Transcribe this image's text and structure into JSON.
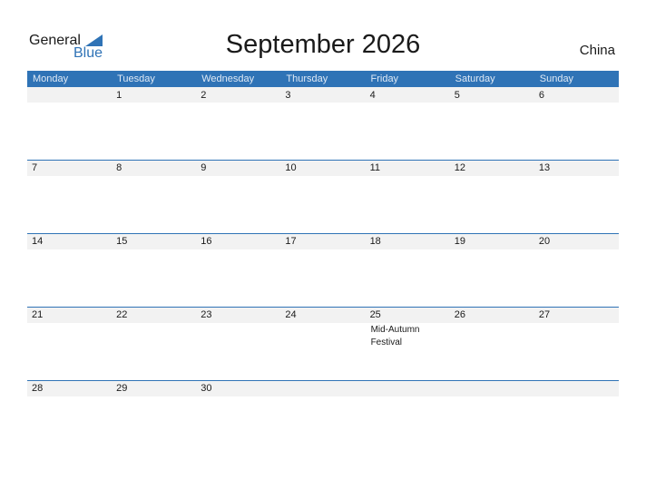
{
  "logo": {
    "text_general": "General",
    "text_blue": "Blue"
  },
  "title": "September 2026",
  "country": "China",
  "colors": {
    "accent": "#2f73b6",
    "strip": "#f2f2f2"
  },
  "weekdays": [
    "Monday",
    "Tuesday",
    "Wednesday",
    "Thursday",
    "Friday",
    "Saturday",
    "Sunday"
  ],
  "weeks": [
    {
      "days": [
        {
          "num": ""
        },
        {
          "num": "1"
        },
        {
          "num": "2"
        },
        {
          "num": "3"
        },
        {
          "num": "4"
        },
        {
          "num": "5"
        },
        {
          "num": "6"
        }
      ]
    },
    {
      "days": [
        {
          "num": "7"
        },
        {
          "num": "8"
        },
        {
          "num": "9"
        },
        {
          "num": "10"
        },
        {
          "num": "11"
        },
        {
          "num": "12"
        },
        {
          "num": "13"
        }
      ]
    },
    {
      "days": [
        {
          "num": "14"
        },
        {
          "num": "15"
        },
        {
          "num": "16"
        },
        {
          "num": "17"
        },
        {
          "num": "18"
        },
        {
          "num": "19"
        },
        {
          "num": "20"
        }
      ]
    },
    {
      "days": [
        {
          "num": "21"
        },
        {
          "num": "22"
        },
        {
          "num": "23"
        },
        {
          "num": "24"
        },
        {
          "num": "25",
          "event": "Mid-Autumn Festival"
        },
        {
          "num": "26"
        },
        {
          "num": "27"
        }
      ]
    },
    {
      "days": [
        {
          "num": "28"
        },
        {
          "num": "29"
        },
        {
          "num": "30"
        },
        {
          "num": ""
        },
        {
          "num": ""
        },
        {
          "num": ""
        },
        {
          "num": ""
        }
      ]
    }
  ]
}
